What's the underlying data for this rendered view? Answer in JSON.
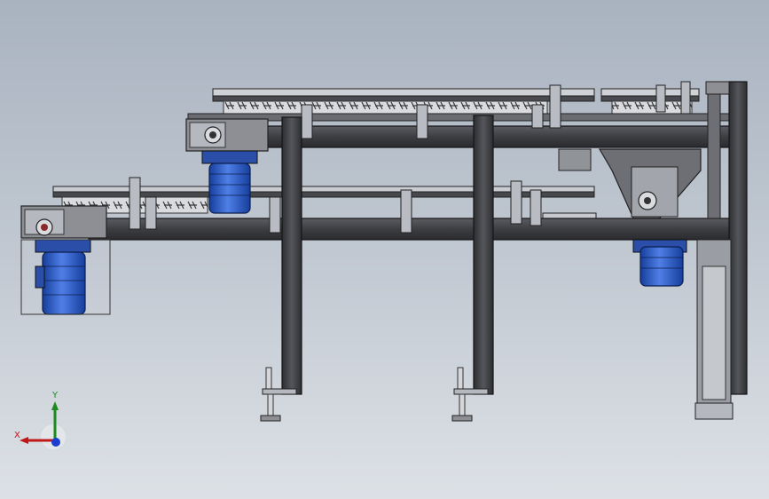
{
  "viewport": {
    "background_top": "#a9b3c0",
    "background_bottom": "#dde1e6"
  },
  "model": {
    "frame_color": "#3f3f42",
    "frame_edge_color": "#151517",
    "rail_color": "#5a5a5e",
    "motor_color": "#1f4fbf",
    "motor_highlight": "#4f7fe6",
    "gearbox_color": "#8d8f94",
    "components": [
      "upper-conveyor",
      "lower-conveyor",
      "motor-upper",
      "motor-lower-left",
      "motor-right",
      "support-leg-left",
      "support-leg-middle",
      "vertical-column-right",
      "leveling-foot-left",
      "leveling-foot-middle"
    ]
  },
  "triad": {
    "y_label": "Y",
    "x_label": "X",
    "x_color": "#c01818",
    "y_color": "#1c8a1c",
    "z_color": "#1a3fd0"
  }
}
